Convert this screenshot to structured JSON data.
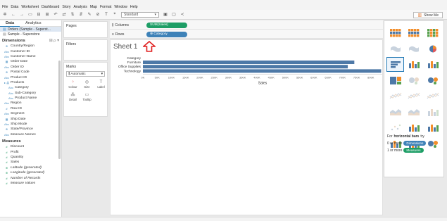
{
  "menu": [
    "File",
    "Data",
    "Worksheet",
    "Dashboard",
    "Story",
    "Analysis",
    "Map",
    "Format",
    "Window",
    "Help"
  ],
  "toolbar": {
    "fit_value": "Standard",
    "show_me_label": "Show Me"
  },
  "data_pane": {
    "tab_data": "Data",
    "tab_analytics": "Analytics",
    "datasources": [
      "Orders (Sample - Superst...",
      "Sample - Superstore"
    ],
    "dimensions_header": "Dimensions",
    "dimensions": [
      {
        "icon": "⊕",
        "label": "Country/Region"
      },
      {
        "icon": "Abc",
        "label": "Customer ID"
      },
      {
        "icon": "Abc",
        "label": "Customer Name"
      },
      {
        "icon": "▦",
        "label": "Order Date"
      },
      {
        "icon": "Abc",
        "label": "Order ID"
      },
      {
        "icon": "⊕",
        "label": "Postal Code"
      },
      {
        "icon": "Abc",
        "label": "Product ID"
      },
      {
        "icon": "▸ ⁂",
        "label": "Products"
      },
      {
        "icon": "Abc",
        "label": "Category"
      },
      {
        "icon": "Abc",
        "label": "Sub-Category"
      },
      {
        "icon": "Abc",
        "label": "Product Name"
      },
      {
        "icon": "Abc",
        "label": "Region"
      },
      {
        "icon": "#",
        "label": "Row ID"
      },
      {
        "icon": "Abc",
        "label": "Segment"
      },
      {
        "icon": "▦",
        "label": "Ship Date"
      },
      {
        "icon": "Abc",
        "label": "Ship Mode"
      },
      {
        "icon": "⊕",
        "label": "State/Province"
      },
      {
        "icon": "Abc",
        "label": "Measure Names"
      }
    ],
    "measures_header": "Measures",
    "measures": [
      {
        "icon": "#",
        "label": "Discount"
      },
      {
        "icon": "#",
        "label": "Profit"
      },
      {
        "icon": "#",
        "label": "Quantity"
      },
      {
        "icon": "#",
        "label": "Sales"
      },
      {
        "icon": "⊕",
        "label": "Latitude (generated)"
      },
      {
        "icon": "⊕",
        "label": "Longitude (generated)"
      },
      {
        "icon": "#",
        "label": "Number of Records"
      },
      {
        "icon": "#",
        "label": "Measure Values"
      }
    ]
  },
  "cards": {
    "pages": "Pages",
    "filters": "Filters",
    "marks": "Marks",
    "mark_type": "Automatic",
    "mark_buttons": [
      "Colour",
      "Size",
      "Label",
      "Detail",
      "Tooltip"
    ]
  },
  "shelves": {
    "columns_label": "Columns",
    "rows_label": "Rows",
    "columns_pill": "SUM(Sales)",
    "rows_pill": "Category"
  },
  "colors": {
    "measure_pill": "#1e9e66",
    "dimension_pill": "#3e82b8",
    "bar": "#4e79a7",
    "arrow": "#e02020"
  },
  "sheet": {
    "title": "Sheet 1",
    "category_header": "Category"
  },
  "chart_data": {
    "type": "bar",
    "orientation": "horizontal",
    "categories": [
      "Furniture",
      "Office Supplies",
      "Technology"
    ],
    "values": [
      742000,
      719047,
      836154
    ],
    "xlabel": "Sales",
    "ylabel": "Category",
    "xlim": [
      0,
      840000
    ],
    "ticks": [
      "0K",
      "50K",
      "100K",
      "150K",
      "200K",
      "250K",
      "300K",
      "350K",
      "400K",
      "450K",
      "500K",
      "550K",
      "600K",
      "650K",
      "700K",
      "750K",
      "800K"
    ]
  },
  "showme": {
    "hint_prefix": "For ",
    "hint_bold": "horizontal bars",
    "hint_suffix": " try",
    "dims_req": "0 or more",
    "dims_pill": "Dimensions",
    "meas_req": "1 or more",
    "meas_pill": "Measures"
  }
}
